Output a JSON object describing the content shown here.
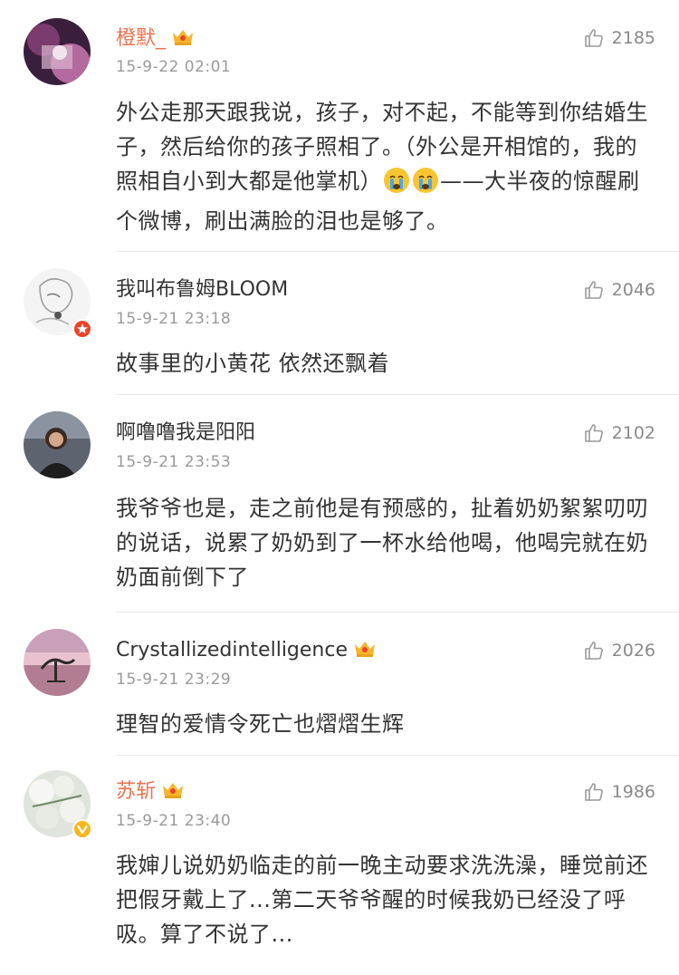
{
  "comments": [
    {
      "username": "橙默_",
      "time": "15-9-22 02:01",
      "likes": "2185",
      "text_before": "外公走那天跟我说，孩子，对不起，不能等到你结婚生子，然后给你的孩子照相了。（外公是开相馆的，我的照相自小到大都是他掌机）",
      "emoji_names": [
        "crying-face-icon",
        "crying-face-icon"
      ],
      "text_after": "——大半夜的惊醒刷个微博，刷出满脸的泪也是够了。"
    },
    {
      "username": "我叫布鲁姆BLOOM",
      "time": "15-9-21 23:18",
      "likes": "2046",
      "text": "故事里的小黄花 依然还飘着"
    },
    {
      "username": "啊噜噜我是阳阳",
      "time": "15-9-21 23:53",
      "likes": "2102",
      "text": "我爷爷也是，走之前他是有预感的，扯着奶奶絮絮叨叨的说话，说累了奶奶到了一杯水给他喝，他喝完就在奶奶面前倒下了"
    },
    {
      "username": "Crystallizedintelligence",
      "time": "15-9-21 23:29",
      "likes": "2026",
      "text": "理智的爱情令死亡也熠熠生辉"
    },
    {
      "username": "苏斩",
      "time": "15-9-21 23:40",
      "likes": "1986",
      "text": "我婶儿说奶奶临走的前一晚主动要求洗洗澡，睡觉前还把假牙戴上了...第二天爷爷醒的时候我奶已经没了呼吸。算了不说了..."
    }
  ],
  "colors": {
    "vip_name": "#eb7350",
    "normal_name": "#333333",
    "timestamp": "#9a9a9a",
    "like": "#8a8a8a",
    "divider": "#e8e8e8",
    "crown": "#f7b52c",
    "verified_red": "#e8452b",
    "verified_yellow": "#f5b81c"
  },
  "icons": {
    "like": "thumbs-up-icon",
    "member": "crown-icon",
    "verified_red": "verified-badge-red-icon",
    "verified_yellow": "verified-badge-yellow-icon"
  }
}
